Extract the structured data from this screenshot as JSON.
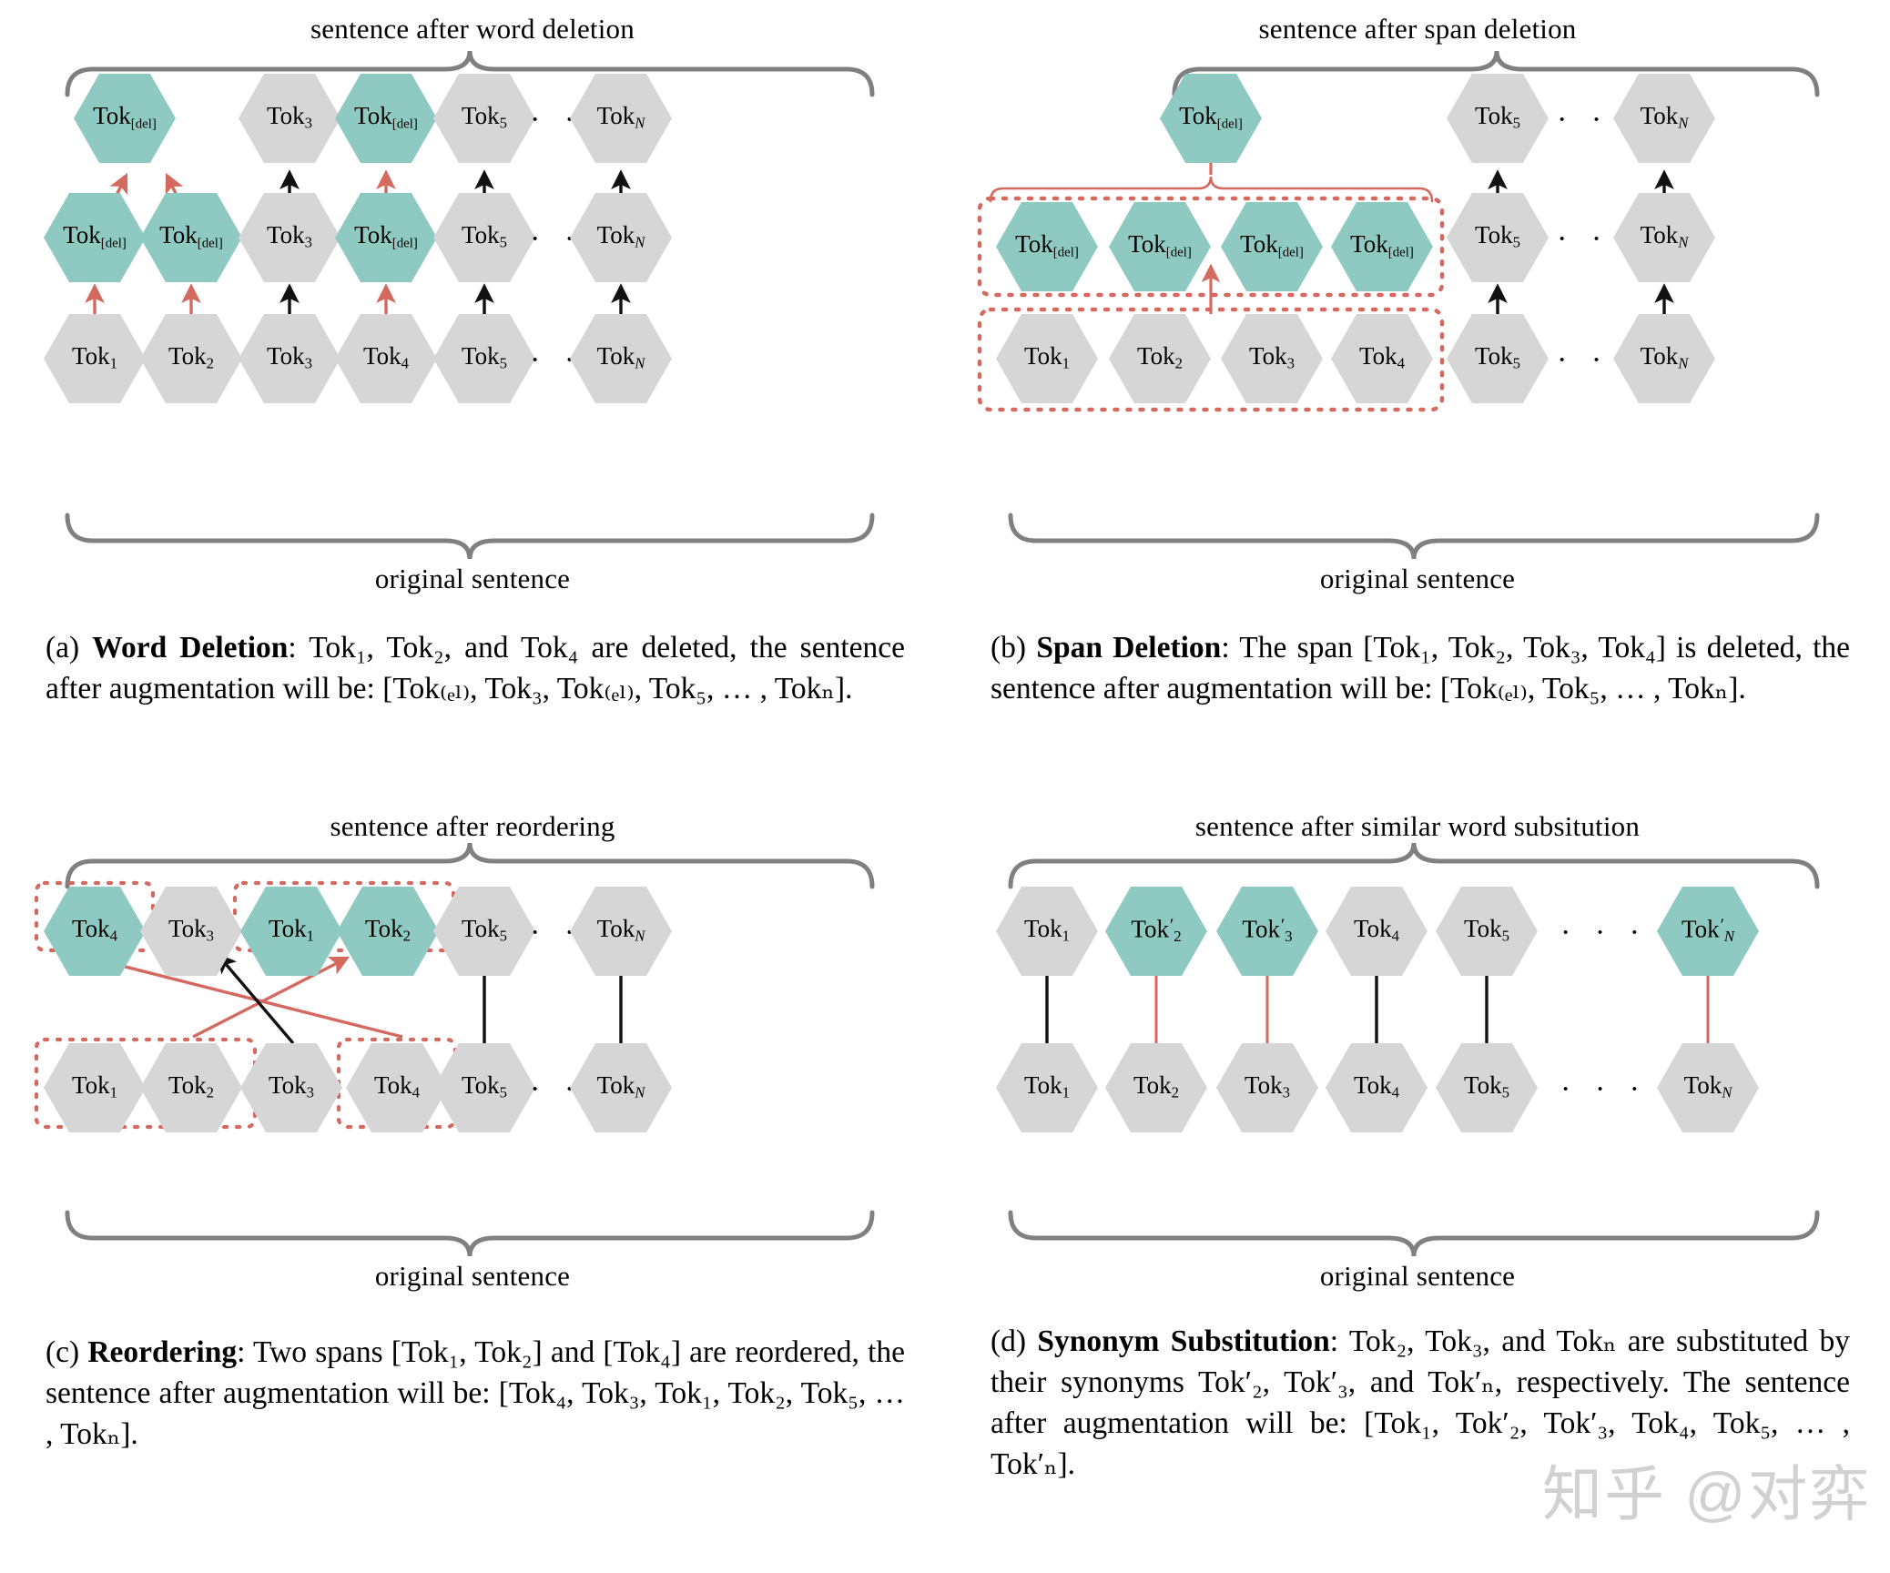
{
  "figure": {
    "teal": "#8fcac2",
    "gray": "#d6d6d6",
    "red": "#d4695f",
    "brace": "#808080",
    "watermark": "知乎 @对弈"
  },
  "panels": {
    "a": {
      "top_label": "sentence after word deletion",
      "bottom_label": "original sentence",
      "rows": {
        "top": [
          {
            "base": "Tok",
            "sub": "[del]",
            "teal": true
          },
          {
            "base": "Tok",
            "sub": "3",
            "teal": false
          },
          {
            "base": "Tok",
            "sub": "[del]",
            "teal": true
          },
          {
            "base": "Tok",
            "sub": "5",
            "teal": false
          },
          {
            "base": "Tok",
            "sub": "N",
            "teal": false,
            "italic": true
          }
        ],
        "middle": [
          {
            "base": "Tok",
            "sub": "[del]",
            "teal": true
          },
          {
            "base": "Tok",
            "sub": "[del]",
            "teal": true
          },
          {
            "base": "Tok",
            "sub": "3",
            "teal": false
          },
          {
            "base": "Tok",
            "sub": "[del]",
            "teal": true
          },
          {
            "base": "Tok",
            "sub": "5",
            "teal": false
          },
          {
            "base": "Tok",
            "sub": "N",
            "teal": false,
            "italic": true
          }
        ],
        "bottom": [
          {
            "base": "Tok",
            "sub": "1",
            "teal": false
          },
          {
            "base": "Tok",
            "sub": "2",
            "teal": false
          },
          {
            "base": "Tok",
            "sub": "3",
            "teal": false
          },
          {
            "base": "Tok",
            "sub": "4",
            "teal": false
          },
          {
            "base": "Tok",
            "sub": "5",
            "teal": false
          },
          {
            "base": "Tok",
            "sub": "N",
            "teal": false,
            "italic": true
          }
        ]
      },
      "ellipsis": "· · ·",
      "caption_tag": "(a)",
      "caption_title": "Word Deletion",
      "caption_body": ": Tok₁, Tok₂, and Tok₄ are deleted, the sentence after augmentation will be: [Tok₍ₑₗ₎, Tok₃, Tok₍ₑₗ₎, Tok₅, … , Tokₙ]."
    },
    "b": {
      "top_label": "sentence after span deletion",
      "bottom_label": "original sentence",
      "rows": {
        "top": [
          {
            "base": "Tok",
            "sub": "[del]",
            "teal": true
          },
          {
            "base": "Tok",
            "sub": "5",
            "teal": false
          },
          {
            "base": "Tok",
            "sub": "N",
            "teal": false,
            "italic": true
          }
        ],
        "middle": [
          {
            "base": "Tok",
            "sub": "[del]",
            "teal": true
          },
          {
            "base": "Tok",
            "sub": "[del]",
            "teal": true
          },
          {
            "base": "Tok",
            "sub": "[del]",
            "teal": true
          },
          {
            "base": "Tok",
            "sub": "[del]",
            "teal": true
          },
          {
            "base": "Tok",
            "sub": "5",
            "teal": false
          },
          {
            "base": "Tok",
            "sub": "N",
            "teal": false,
            "italic": true
          }
        ],
        "bottom": [
          {
            "base": "Tok",
            "sub": "1",
            "teal": false
          },
          {
            "base": "Tok",
            "sub": "2",
            "teal": false
          },
          {
            "base": "Tok",
            "sub": "3",
            "teal": false
          },
          {
            "base": "Tok",
            "sub": "4",
            "teal": false
          },
          {
            "base": "Tok",
            "sub": "5",
            "teal": false
          },
          {
            "base": "Tok",
            "sub": "N",
            "teal": false,
            "italic": true
          }
        ]
      },
      "ellipsis": "· · ·",
      "caption_tag": "(b)",
      "caption_title": "Span Deletion",
      "caption_body": ": The span [Tok₁, Tok₂, Tok₃, Tok₄] is deleted, the sentence after augmentation will be: [Tok₍ₑₗ₎, Tok₅, … , Tokₙ]."
    },
    "c": {
      "top_label": "sentence after reordering",
      "bottom_label": "original sentence",
      "rows": {
        "top": [
          {
            "base": "Tok",
            "sub": "4",
            "teal": true
          },
          {
            "base": "Tok",
            "sub": "3",
            "teal": false
          },
          {
            "base": "Tok",
            "sub": "1",
            "teal": true
          },
          {
            "base": "Tok",
            "sub": "2",
            "teal": true
          },
          {
            "base": "Tok",
            "sub": "5",
            "teal": false
          },
          {
            "base": "Tok",
            "sub": "N",
            "teal": false,
            "italic": true
          }
        ],
        "bottom": [
          {
            "base": "Tok",
            "sub": "1",
            "teal": false
          },
          {
            "base": "Tok",
            "sub": "2",
            "teal": false
          },
          {
            "base": "Tok",
            "sub": "3",
            "teal": false
          },
          {
            "base": "Tok",
            "sub": "4",
            "teal": false
          },
          {
            "base": "Tok",
            "sub": "5",
            "teal": false
          },
          {
            "base": "Tok",
            "sub": "N",
            "teal": false,
            "italic": true
          }
        ]
      },
      "ellipsis": "· · ·",
      "caption_tag": "(c)",
      "caption_title": "Reordering",
      "caption_body": ": Two spans [Tok₁, Tok₂] and [Tok₄] are reordered, the sentence after augmentation will be: [Tok₄, Tok₃, Tok₁, Tok₂, Tok₅, … , Tokₙ]."
    },
    "d": {
      "top_label": "sentence after similar word subsitution",
      "bottom_label": "original sentence",
      "rows": {
        "top": [
          {
            "base": "Tok",
            "sub": "1",
            "teal": false
          },
          {
            "base": "Tok",
            "sub": "2",
            "prime": true,
            "teal": true
          },
          {
            "base": "Tok",
            "sub": "3",
            "prime": true,
            "teal": true
          },
          {
            "base": "Tok",
            "sub": "4",
            "teal": false
          },
          {
            "base": "Tok",
            "sub": "5",
            "teal": false
          },
          {
            "base": "Tok",
            "sub": "N",
            "prime": true,
            "teal": true,
            "italic": true
          }
        ],
        "bottom": [
          {
            "base": "Tok",
            "sub": "1",
            "teal": false
          },
          {
            "base": "Tok",
            "sub": "2",
            "teal": false
          },
          {
            "base": "Tok",
            "sub": "3",
            "teal": false
          },
          {
            "base": "Tok",
            "sub": "4",
            "teal": false
          },
          {
            "base": "Tok",
            "sub": "5",
            "teal": false
          },
          {
            "base": "Tok",
            "sub": "N",
            "teal": false,
            "italic": true
          }
        ]
      },
      "ellipsis": "· · ·",
      "caption_tag": "(d)",
      "caption_title": "Synonym Substitution",
      "caption_body": ": Tok₂, Tok₃, and Tokₙ are substituted by their synonyms Tok′₂, Tok′₃, and Tok′ₙ, respectively. The sentence after augmentation will be: [Tok₁, Tok′₂, Tok′₃, Tok₄, Tok₅, … , Tok′ₙ]."
    }
  }
}
